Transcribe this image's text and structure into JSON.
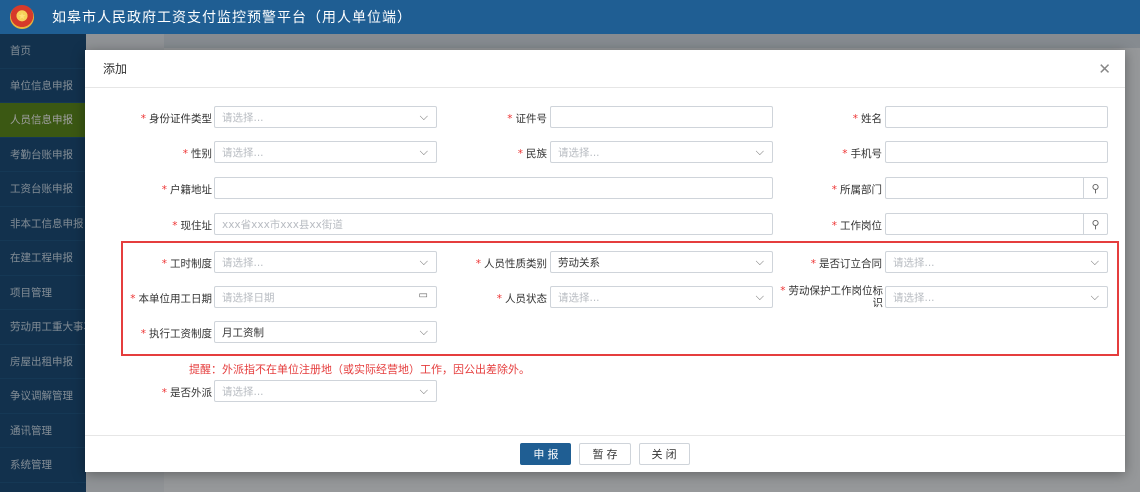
{
  "app": {
    "title": "如皋市人民政府工资支付监控预警平台（用人单位端）"
  },
  "sidebar": {
    "items": [
      {
        "label": "首页"
      },
      {
        "label": "单位信息申报"
      },
      {
        "label": "人员信息申报",
        "active": true
      },
      {
        "label": "考勤台账申报"
      },
      {
        "label": "工资台账申报"
      },
      {
        "label": "非本工信息申报"
      },
      {
        "label": "在建工程申报"
      },
      {
        "label": "项目管理"
      },
      {
        "label": "劳动用工重大事项"
      },
      {
        "label": "房屋出租申报"
      },
      {
        "label": "争议调解管理"
      },
      {
        "label": "通讯管理"
      },
      {
        "label": "系统管理"
      }
    ]
  },
  "dialog": {
    "title": "添加",
    "close_icon": "close-icon",
    "fields": {
      "id_type": {
        "label": "身份证件类型",
        "placeholder": "请选择..."
      },
      "id_number": {
        "label": "证件号",
        "value": ""
      },
      "name": {
        "label": "姓名",
        "value": ""
      },
      "gender": {
        "label": "性别",
        "placeholder": "请选择..."
      },
      "ethnicity": {
        "label": "民族",
        "placeholder": "请选择..."
      },
      "phone": {
        "label": "手机号",
        "value": ""
      },
      "household_address": {
        "label": "户籍地址",
        "value": ""
      },
      "department": {
        "label": "所属部门",
        "value": ""
      },
      "current_address": {
        "label": "现住址",
        "placeholder": "xxx省xxx市xxx县xx街道"
      },
      "job_position": {
        "label": "工作岗位",
        "value": ""
      },
      "work_hour_system": {
        "label": "工时制度",
        "placeholder": "请选择..."
      },
      "personnel_type": {
        "label": "人员性质类别",
        "value": "劳动关系"
      },
      "signed_contract": {
        "label": "是否订立合同",
        "placeholder": "请选择..."
      },
      "employment_date": {
        "label": "本单位用工日期",
        "placeholder": "请选择日期"
      },
      "personnel_status": {
        "label": "人员状态",
        "placeholder": "请选择..."
      },
      "labor_protection_job": {
        "label_line1": "劳动保护工作岗位标",
        "label_line2": "识",
        "placeholder": "请选择..."
      },
      "wage_system": {
        "label": "执行工资制度",
        "value": "月工资制"
      },
      "is_dispatched": {
        "label": "是否外派",
        "placeholder": "请选择..."
      }
    },
    "notice": "提醒：外派指不在单位注册地（或实际经营地）工作，因公出差除外。",
    "buttons": {
      "submit": "申 报",
      "save": "暂 存",
      "close": "关 闭"
    }
  }
}
